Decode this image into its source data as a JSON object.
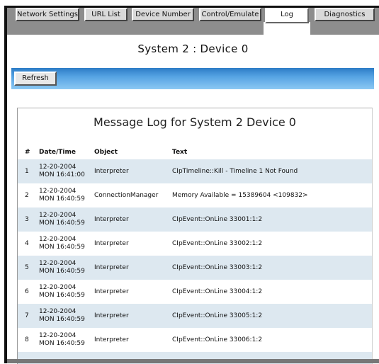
{
  "tabs": [
    {
      "label": "Network Settings",
      "active": false
    },
    {
      "label": "URL List",
      "active": false
    },
    {
      "label": "Device Number",
      "active": false
    },
    {
      "label": "Control/Emulate",
      "active": false
    },
    {
      "label": "Log",
      "active": true
    },
    {
      "label": "Diagnostics",
      "active": false
    }
  ],
  "page": {
    "title": "System 2 : Device 0"
  },
  "toolbar": {
    "refresh_label": "Refresh"
  },
  "log": {
    "title": "Message Log for System 2 Device 0",
    "headers": {
      "num": "#",
      "datetime": "Date/Time",
      "object": "Object",
      "text": "Text"
    },
    "rows": [
      {
        "num": "1",
        "date": "12-20-2004",
        "time": "MON 16:41:00",
        "object": "Interpreter",
        "text": "CIpTimeline::Kill - Timeline 1 Not Found"
      },
      {
        "num": "2",
        "date": "12-20-2004",
        "time": "MON 16:40:59",
        "object": "ConnectionManager",
        "text": "Memory Available = 15389604 <109832>"
      },
      {
        "num": "3",
        "date": "12-20-2004",
        "time": "MON 16:40:59",
        "object": "Interpreter",
        "text": "CIpEvent::OnLine 33001:1:2"
      },
      {
        "num": "4",
        "date": "12-20-2004",
        "time": "MON 16:40:59",
        "object": "Interpreter",
        "text": "CIpEvent::OnLine 33002:1:2"
      },
      {
        "num": "5",
        "date": "12-20-2004",
        "time": "MON 16:40:59",
        "object": "Interpreter",
        "text": "CIpEvent::OnLine 33003:1:2"
      },
      {
        "num": "6",
        "date": "12-20-2004",
        "time": "MON 16:40:59",
        "object": "Interpreter",
        "text": "CIpEvent::OnLine 33004:1:2"
      },
      {
        "num": "7",
        "date": "12-20-2004",
        "time": "MON 16:40:59",
        "object": "Interpreter",
        "text": "CIpEvent::OnLine 33005:1:2"
      },
      {
        "num": "8",
        "date": "12-20-2004",
        "time": "MON 16:40:59",
        "object": "Interpreter",
        "text": "CIpEvent::OnLine 33006:1:2"
      }
    ]
  },
  "colors": {
    "toolbar_top": "#2d7cc6",
    "toolbar_bottom": "#8cc8f3",
    "row_alt": "#dde8f0",
    "tabbar_bg": "#8d8d8d"
  }
}
